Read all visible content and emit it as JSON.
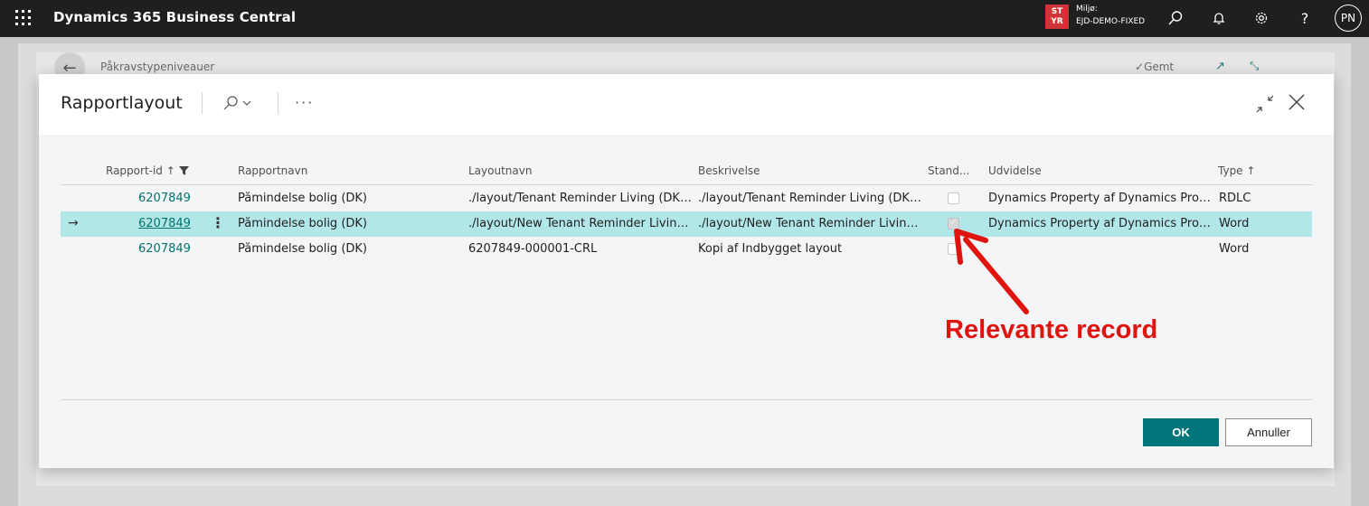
{
  "topbar": {
    "app_title": "Dynamics 365 Business Central",
    "env_badge_line1": "ST",
    "env_badge_line2": "YR",
    "env_label": "Miljø:",
    "env_name": "EJD-DEMO-FIXED",
    "avatar_initials": "PN",
    "icons": [
      "search-icon",
      "bell-icon",
      "gear-icon",
      "help-icon"
    ]
  },
  "background_page": {
    "title": "Påkravstypeniveauer",
    "saved_label": "Gemt"
  },
  "dialog": {
    "title": "Rapportlayout",
    "more_label": "···",
    "columns": {
      "report_id": "Rapport-id",
      "report_name": "Rapportnavn",
      "layout_name": "Layoutnavn",
      "description": "Beskrivelse",
      "default": "Stand...",
      "extension": "Udvidelse",
      "type": "Type"
    },
    "rows": [
      {
        "report_id": "6207849",
        "report_name": "Påmindelse bolig (DK)",
        "layout_name": "./layout/Tenant Reminder Living (DK).rdl",
        "description": "./layout/Tenant Reminder Living (DK).rdl",
        "default": false,
        "extension": "Dynamics Property af Dynamics Prope...",
        "type": "RDLC",
        "selected": false
      },
      {
        "report_id": "6207849",
        "report_name": "Påmindelse bolig (DK)",
        "layout_name": "./layout/New Tenant Reminder Living (...",
        "description": "./layout/New Tenant Reminder Living (...",
        "default": true,
        "extension": "Dynamics Property af Dynamics Prope...",
        "type": "Word",
        "selected": true
      },
      {
        "report_id": "6207849",
        "report_name": "Påmindelse bolig (DK)",
        "layout_name": "6207849-000001-CRL",
        "description": "Kopi af Indbygget layout",
        "default": false,
        "extension": "",
        "type": "Word",
        "selected": false
      }
    ],
    "ok_label": "OK",
    "cancel_label": "Annuller"
  },
  "annotation": {
    "text": "Relevante record",
    "color": "#e0140f"
  },
  "colors": {
    "accent": "#00757a",
    "selected_row": "#b2e7ea",
    "topbar": "#1f1f1f",
    "env_badge": "#d13438"
  }
}
